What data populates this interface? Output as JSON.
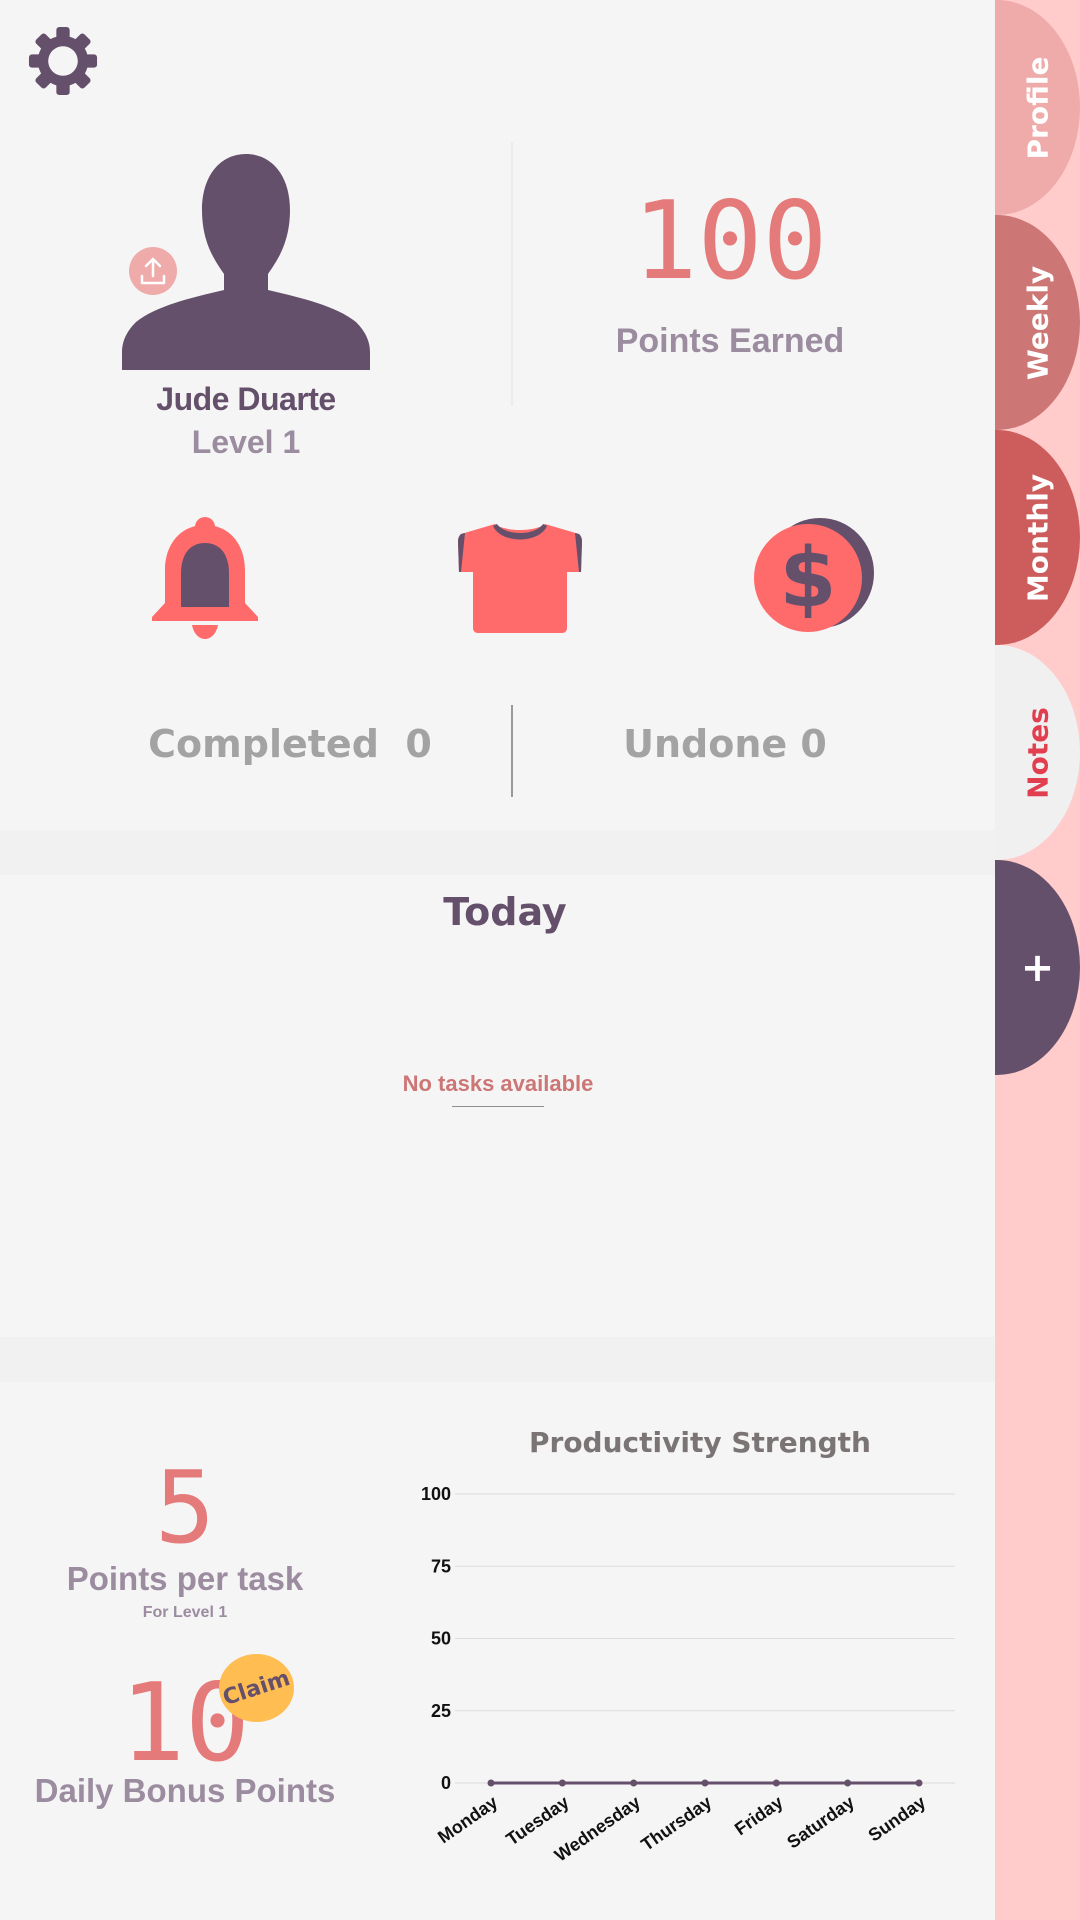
{
  "colors": {
    "accent": "#e57a7a",
    "primary": "#65506c",
    "muted": "#9b8ca0",
    "claim": "#ffbd52"
  },
  "tabs": [
    {
      "label": "Profile"
    },
    {
      "label": "Weekly"
    },
    {
      "label": "Monthly"
    },
    {
      "label": "Notes"
    },
    {
      "label": "+"
    }
  ],
  "profile": {
    "name": "Jude Duarte",
    "level": "Level 1",
    "upload_icon": "upload-icon",
    "avatar_icon": "person-silhouette"
  },
  "points": {
    "value": "100",
    "label": "Points Earned"
  },
  "quick_icons": [
    "bell-icon",
    "shirt-icon",
    "coin-icon"
  ],
  "tasks_summary": {
    "completed_label": "Completed",
    "completed_count": "0",
    "undone_label": "Undone",
    "undone_count": "0"
  },
  "today": {
    "title": "Today",
    "empty_message": "No tasks available"
  },
  "stats": {
    "points_per_task_value": "5",
    "points_per_task_label": "Points per task",
    "points_per_task_sub": "For Level 1",
    "bonus_value": "10",
    "bonus_label": "Daily Bonus Points",
    "claim_label": "Claim"
  },
  "chart_data": {
    "type": "line",
    "title": "Productivity Strength",
    "categories": [
      "Monday",
      "Tuesday",
      "Wednesday",
      "Thursday",
      "Friday",
      "Saturday",
      "Sunday"
    ],
    "series": [
      {
        "values": [
          0,
          0,
          0,
          0,
          0,
          0,
          0
        ]
      }
    ],
    "yticks": [
      0,
      25,
      50,
      75,
      100
    ],
    "ylim": [
      0,
      100
    ],
    "xlabel": "",
    "ylabel": "",
    "grid": true,
    "line_color": "#65506c"
  }
}
